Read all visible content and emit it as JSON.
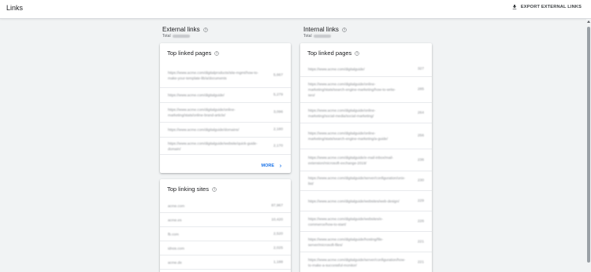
{
  "header": {
    "title": "Links",
    "export_label": "EXPORT EXTERNAL LINKS"
  },
  "external": {
    "heading": "External links",
    "total_label": "Total",
    "top_linked_pages": {
      "title": "Top linked pages",
      "rows": [
        {
          "url": "https://www.acme.com/digitalproducts/site-mgmt/how-to-make-your-template-lib/a/documents",
          "count": "5,667"
        },
        {
          "url": "https://www.acme.com/digitalguide/",
          "count": "5,279"
        },
        {
          "url": "https://www.acme.com/digitalguide/online-marketing/stats/online-brand-article/",
          "count": "3,096"
        },
        {
          "url": "https://www.acme.com/digitalguide/domains/",
          "count": "2,180"
        },
        {
          "url": "https://www.acme.com/digitalguide/website/quick-guide-domain/",
          "count": "2,170"
        }
      ],
      "more_label": "MORE"
    },
    "top_linking_sites": {
      "title": "Top linking sites",
      "rows": [
        {
          "url": "acme.com",
          "count": "87,967"
        },
        {
          "url": "acme.es",
          "count": "10,420"
        },
        {
          "url": "fb.com",
          "count": "2,520"
        },
        {
          "url": "idnos.com",
          "count": "2,025"
        },
        {
          "url": "acme.de",
          "count": "1,188"
        }
      ]
    }
  },
  "internal": {
    "heading": "Internal links",
    "total_label": "Total",
    "top_linked_pages": {
      "title": "Top linked pages",
      "rows": [
        {
          "url": "https://www.acme.com/digitalguide/",
          "count": "327"
        },
        {
          "url": "https://www.acme.com/digitalguide/online-marketing/stats/search-engine-marketing/how-to-write-seo/",
          "count": "285"
        },
        {
          "url": "https://www.acme.com/digitalguide/online-marketing/social-media/social-marketing/",
          "count": "264"
        },
        {
          "url": "https://www.acme.com/digitalguide/online-marketing/stats/search-engine-marketing/a-guide/",
          "count": "256"
        },
        {
          "url": "https://www.acme.com/digitalguide/e-mail-inbox/mail-extension/microsoft-exchange-2019/",
          "count": "236"
        },
        {
          "url": "https://www.acme.com/digitalguide/server/configuration/unix-list/",
          "count": "230"
        },
        {
          "url": "https://www.acme.com/digitalguide/websites/web-design/",
          "count": "229"
        },
        {
          "url": "https://www.acme.com/digitalguide/websites/e-commerce/how-to-start/",
          "count": "226"
        },
        {
          "url": "https://www.acme.com/digitalguide/hosting/file-server/microsoft-files/",
          "count": "221"
        },
        {
          "url": "https://www.acme.com/digitalguide/server/configuration/how-to-make-a-successful-monitor/",
          "count": "221"
        }
      ]
    }
  },
  "colors": {
    "accent": "#1a73e8",
    "background": "#f1f3f4"
  }
}
